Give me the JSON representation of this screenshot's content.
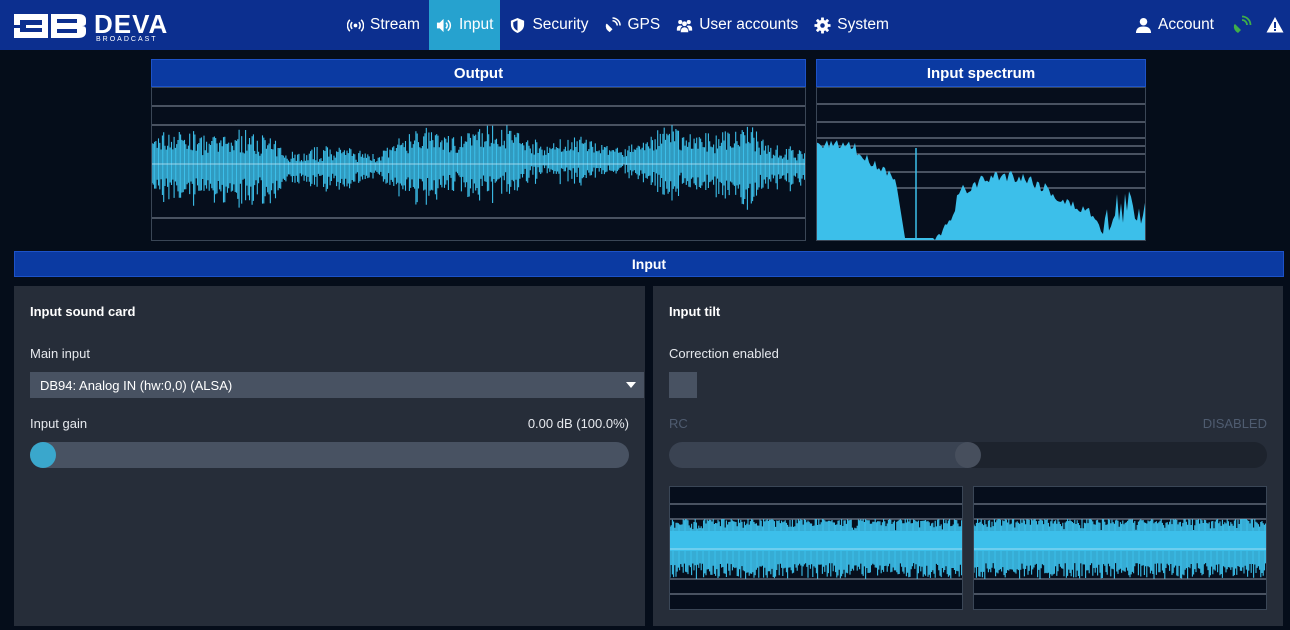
{
  "brand": {
    "name": "DEVA",
    "sub": "BROADCAST"
  },
  "nav": {
    "items": [
      {
        "key": "stream",
        "label": "Stream",
        "icon": "broadcast-icon"
      },
      {
        "key": "input",
        "label": "Input",
        "icon": "speaker-icon"
      },
      {
        "key": "security",
        "label": "Security",
        "icon": "shield-icon"
      },
      {
        "key": "gps",
        "label": "GPS",
        "icon": "satellite-icon"
      },
      {
        "key": "users",
        "label": "User accounts",
        "icon": "users-icon"
      },
      {
        "key": "system",
        "label": "System",
        "icon": "gear-icon"
      }
    ],
    "active": "input",
    "account_label": "Account"
  },
  "meters": {
    "output_title": "Output",
    "spectrum_title": "Input spectrum"
  },
  "section": {
    "title": "Input"
  },
  "left_panel": {
    "title": "Input sound card",
    "main_input_label": "Main input",
    "main_input_value": "DB94: Analog IN (hw:0,0) (ALSA)",
    "gain_label": "Input gain",
    "gain_value": "0.00 dB (100.0%)",
    "gain_slider_fraction": 0.0
  },
  "right_panel": {
    "title": "Input tilt",
    "correction_label": "Correction enabled",
    "correction_checked": false,
    "rc_label": "RC",
    "rc_status": "DISABLED",
    "rc_slider_fraction": 0.5
  },
  "colors": {
    "navbar": "#0c2f8f",
    "active_tab": "#26a2cf",
    "wave": "#3cbfea",
    "header_blue": "#0b3aa2",
    "panel": "#262d39",
    "status_green": "#3fae49"
  }
}
